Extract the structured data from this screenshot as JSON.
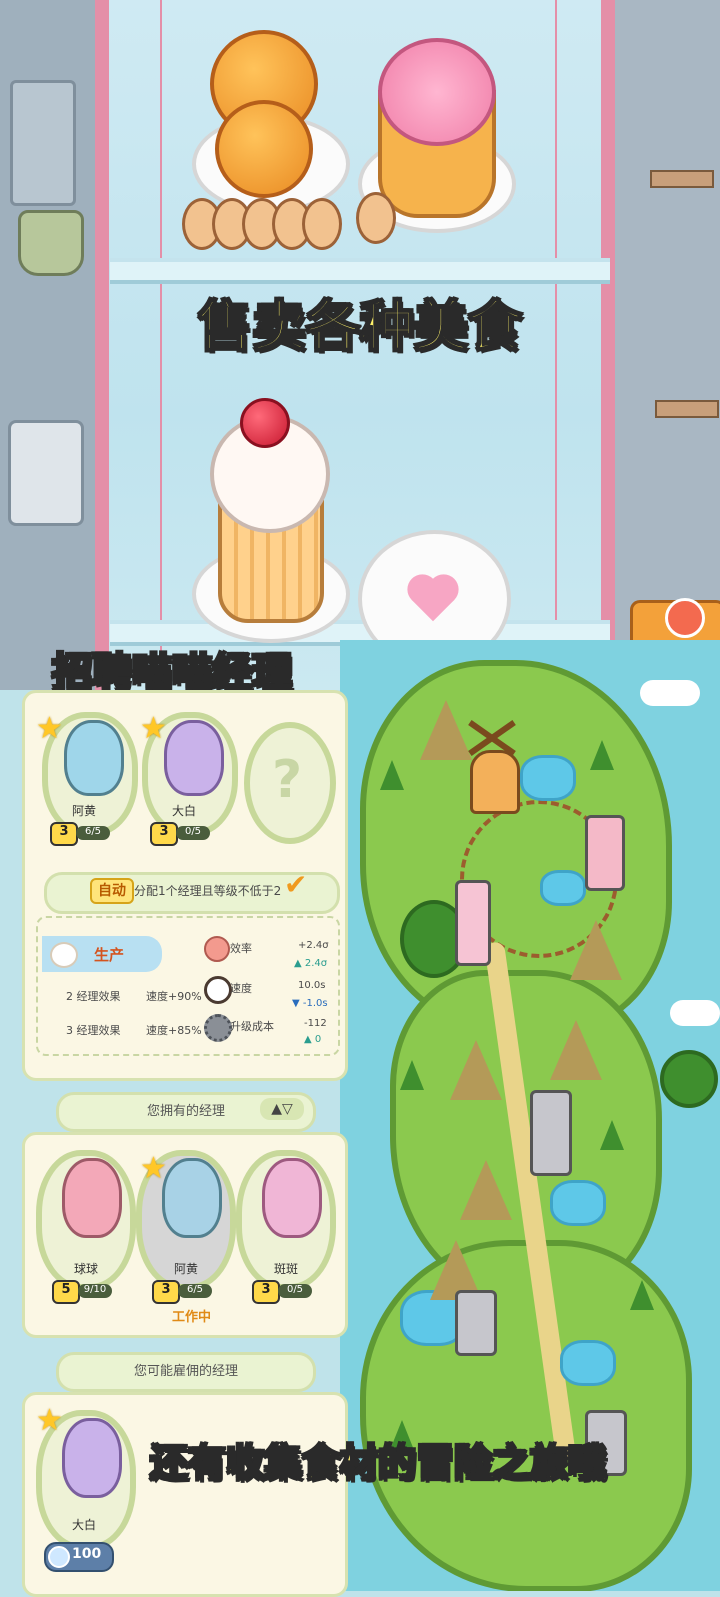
{
  "captions": {
    "top": "售卖各种美食",
    "recruit": "招聘喵喵经理",
    "adventure": "还有收集食材的冒险之旅哦"
  },
  "manager_slots": [
    {
      "name": "阿黄",
      "level": "3",
      "progress": "6/5",
      "color": "#9fd6ea"
    },
    {
      "name": "大白",
      "level": "3",
      "progress": "0/5",
      "color": "#c9b2ea"
    }
  ],
  "empty_slot_symbol": "?",
  "auto_rule": {
    "tag": "自动",
    "text": "分配1个经理且等级不低于2",
    "check": "✔"
  },
  "production": {
    "tag": "生产",
    "rows": [
      {
        "label": "2 经理效果",
        "speed": "速度+90%"
      },
      {
        "label": "3 经理效果",
        "speed": "速度+85%"
      }
    ],
    "stats": [
      {
        "name": "效率",
        "value": "+2.4σ",
        "delta": "▲ 2.4σ",
        "icon": "flower-icon"
      },
      {
        "name": "速度",
        "value": "10.0s",
        "delta": "▼ -1.0s",
        "icon": "clock-icon"
      },
      {
        "name": "升级成本",
        "value": "-112",
        "delta": "▲ 0",
        "icon": "gear-icon"
      }
    ]
  },
  "owned_section": {
    "title": "您拥有的经理",
    "sort_button": "▲▽",
    "managers": [
      {
        "name": "球球",
        "level": "5",
        "progress": "9/10",
        "color": "#f3a8b8",
        "starred": false,
        "status": ""
      },
      {
        "name": "阿黄",
        "level": "3",
        "progress": "6/5",
        "color": "#a8d2e6",
        "starred": true,
        "status": "工作中"
      },
      {
        "name": "斑斑",
        "level": "3",
        "progress": "0/5",
        "color": "#f0b6d6",
        "starred": false,
        "status": ""
      }
    ]
  },
  "hire_section": {
    "title": "您可能雇佣的经理",
    "managers": [
      {
        "name": "大白",
        "cost": "100",
        "color": "#c9b2ea",
        "starred": true
      }
    ]
  },
  "colors": {
    "caption_fill": "#fff36a",
    "panel_bg": "#fbf7e4",
    "panel_border": "#d7e2b0",
    "sea": "#7fd2e0",
    "grass": "#8bc94e",
    "showcase_frame": "#e48fa8"
  }
}
